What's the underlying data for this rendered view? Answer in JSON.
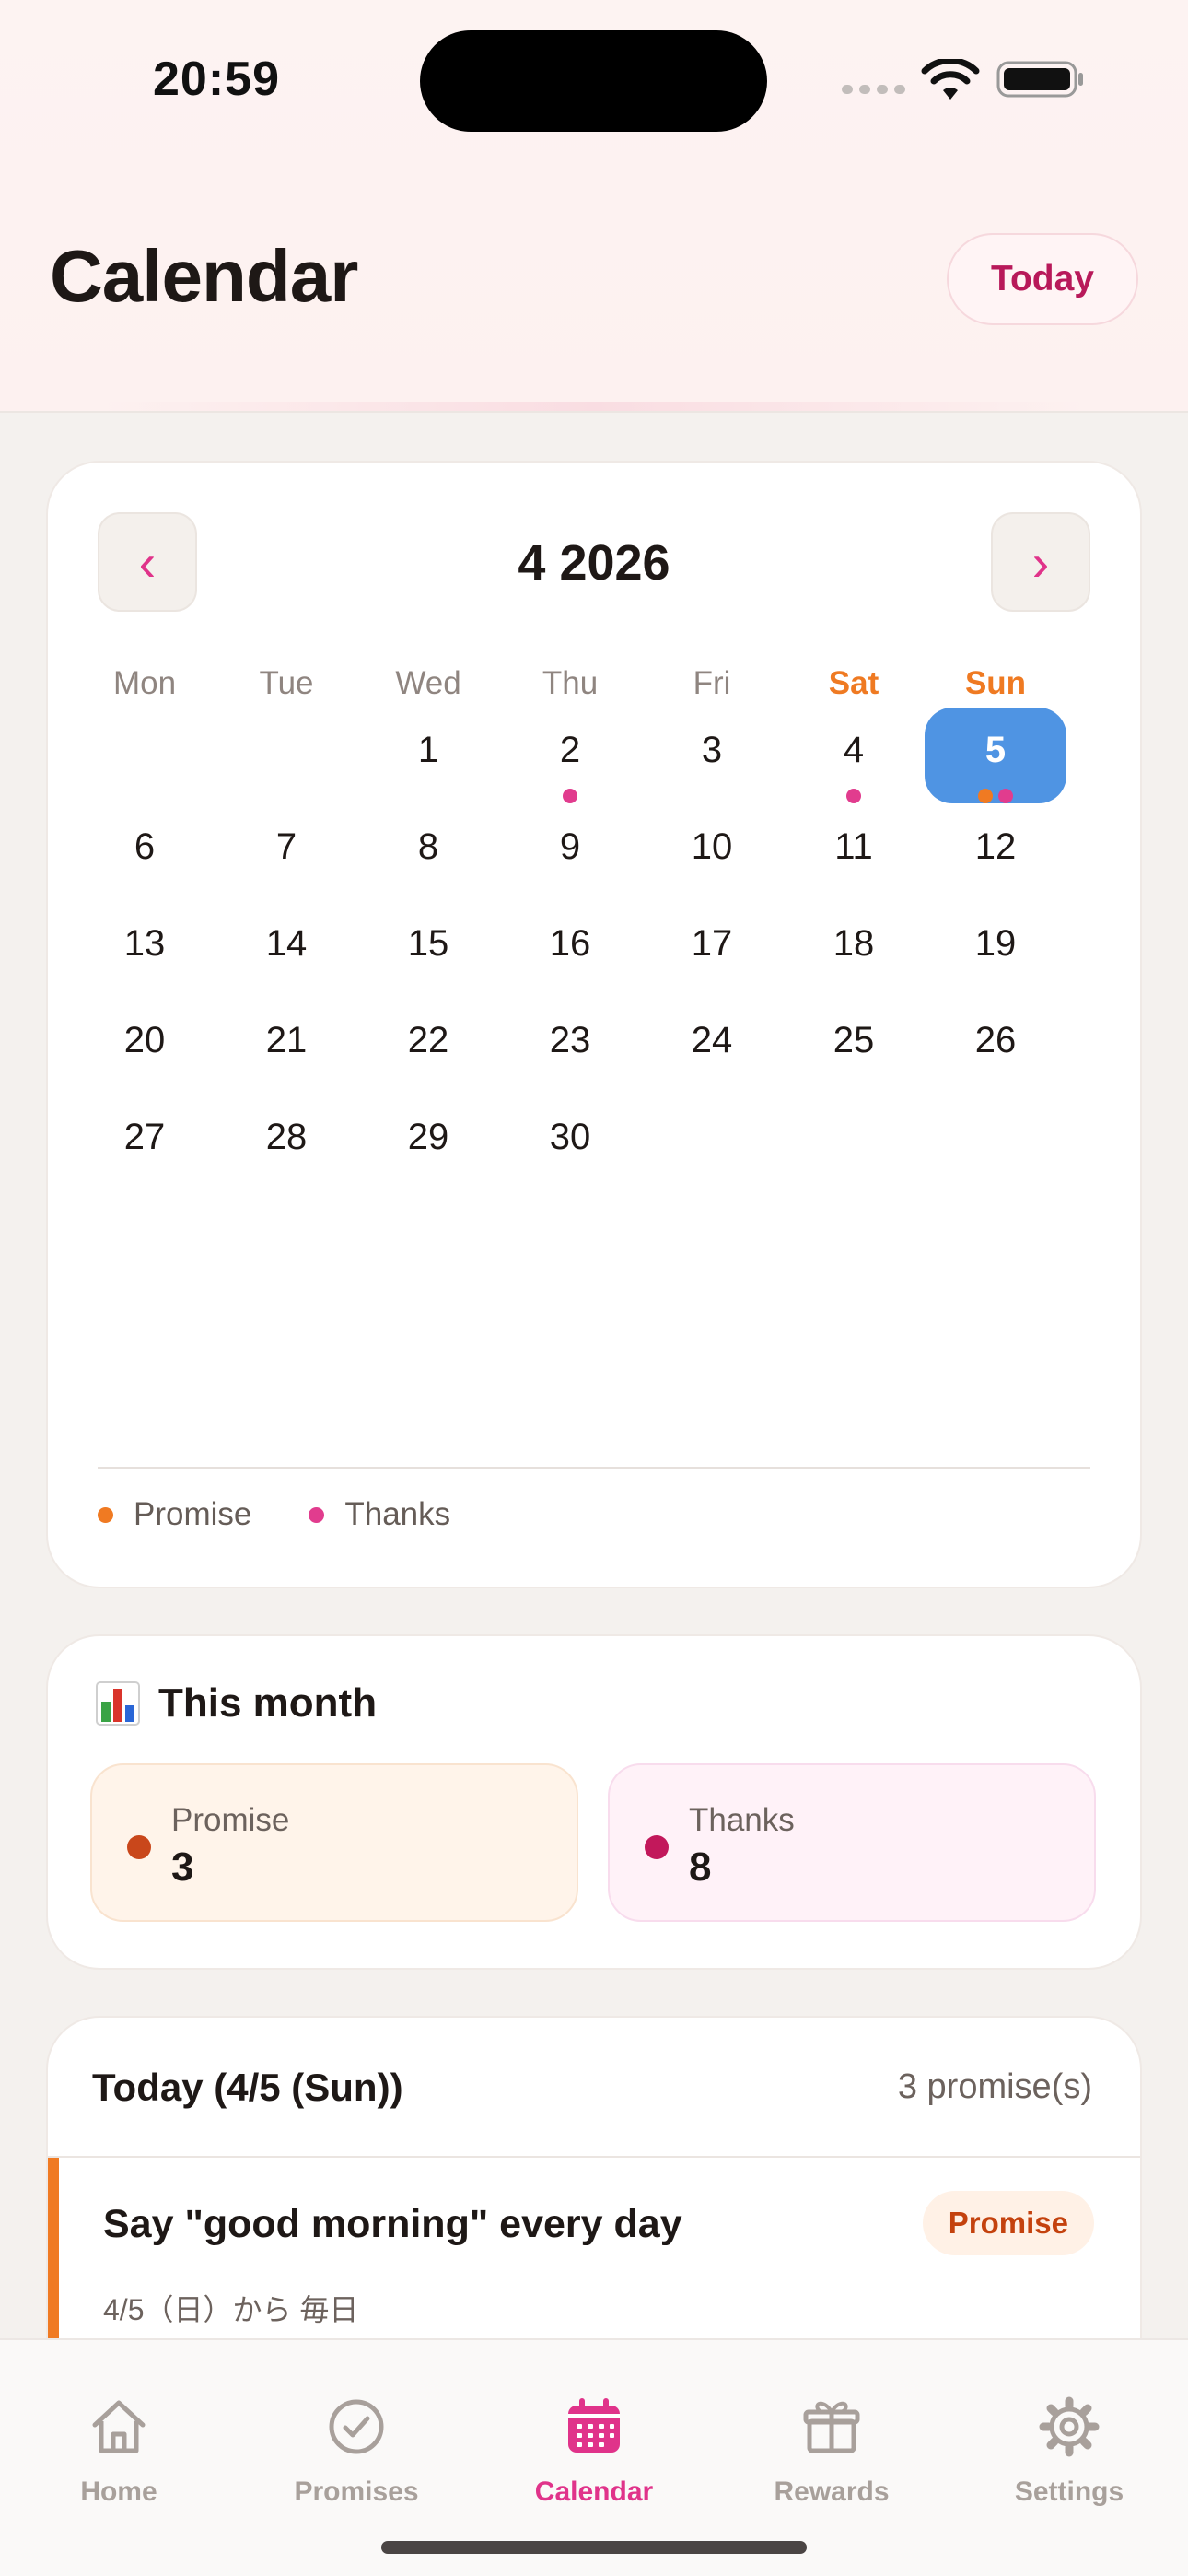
{
  "status_bar": {
    "time": "20:59"
  },
  "header": {
    "title": "Calendar",
    "today_button": "Today"
  },
  "calendar": {
    "month_label": "4 2026",
    "prev_label": "‹",
    "next_label": "›",
    "weekdays": [
      "Mon",
      "Tue",
      "Wed",
      "Thu",
      "Fri",
      "Sat",
      "Sun"
    ],
    "weeks": [
      [
        "",
        "",
        "1",
        "2",
        "3",
        "4",
        "5"
      ],
      [
        "6",
        "7",
        "8",
        "9",
        "10",
        "11",
        "12"
      ],
      [
        "13",
        "14",
        "15",
        "16",
        "17",
        "18",
        "19"
      ],
      [
        "20",
        "21",
        "22",
        "23",
        "24",
        "25",
        "26"
      ],
      [
        "27",
        "28",
        "29",
        "30",
        "",
        "",
        ""
      ]
    ],
    "selected_day": "5",
    "markers": {
      "2": [
        "thanks"
      ],
      "4": [
        "thanks"
      ],
      "5": [
        "promise",
        "thanks"
      ]
    },
    "legend": {
      "promise": "Promise",
      "thanks": "Thanks"
    }
  },
  "stats": {
    "title": "This month",
    "title_icon": "bar-chart-icon",
    "promise": {
      "label": "Promise",
      "value": "3"
    },
    "thanks": {
      "label": "Thanks",
      "value": "8"
    }
  },
  "today": {
    "heading": "Today (4/5 (Sun))",
    "count": "3 promise(s)",
    "items": [
      {
        "title": "Say \"good morning\" every day",
        "subtitle": "4/5（日）から 毎日",
        "badge": "Promise"
      }
    ]
  },
  "tabbar": {
    "home": "Home",
    "promises": "Promises",
    "calendar": "Calendar",
    "rewards": "Rewards",
    "settings": "Settings",
    "active": "calendar"
  },
  "colors": {
    "accent": "#e0338a",
    "promise": "#f07a22",
    "thanks": "#e13c8e",
    "selected": "#4f94e3",
    "weekend": "#ef7a22",
    "stat_promise_dot": "#c9471b",
    "stat_thanks_dot": "#c2185b"
  }
}
